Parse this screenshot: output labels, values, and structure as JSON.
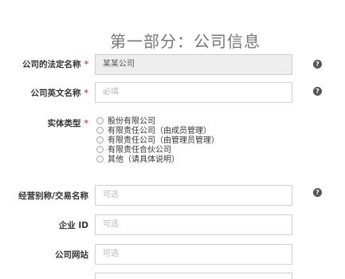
{
  "section_title": "第一部分：公司信息",
  "required_mark": "*",
  "help_glyph": "?",
  "fields": {
    "legal_name": {
      "label": "公司的法定名称",
      "value": "某某公司"
    },
    "english_name": {
      "label": "公司英文名称",
      "placeholder": "必填"
    },
    "entity_type": {
      "label": "实体类型",
      "options": [
        "股份有限公司",
        "有限责任公司（由成员管理）",
        "有限责任公司（由管理员管理）",
        "有限责任合伙公司",
        "其他（请具体说明）"
      ]
    },
    "dba_name": {
      "label": "经营别称/交易名称",
      "placeholder": "可选"
    },
    "enterprise_id": {
      "label": "企业 ID",
      "placeholder": "可选"
    },
    "website": {
      "label": "公司网站",
      "placeholder": "可选"
    }
  },
  "colors": {
    "required": "#d9534f",
    "readonly_bg": "#eeeeee",
    "border": "#cfcfcf",
    "title": "#777777"
  }
}
